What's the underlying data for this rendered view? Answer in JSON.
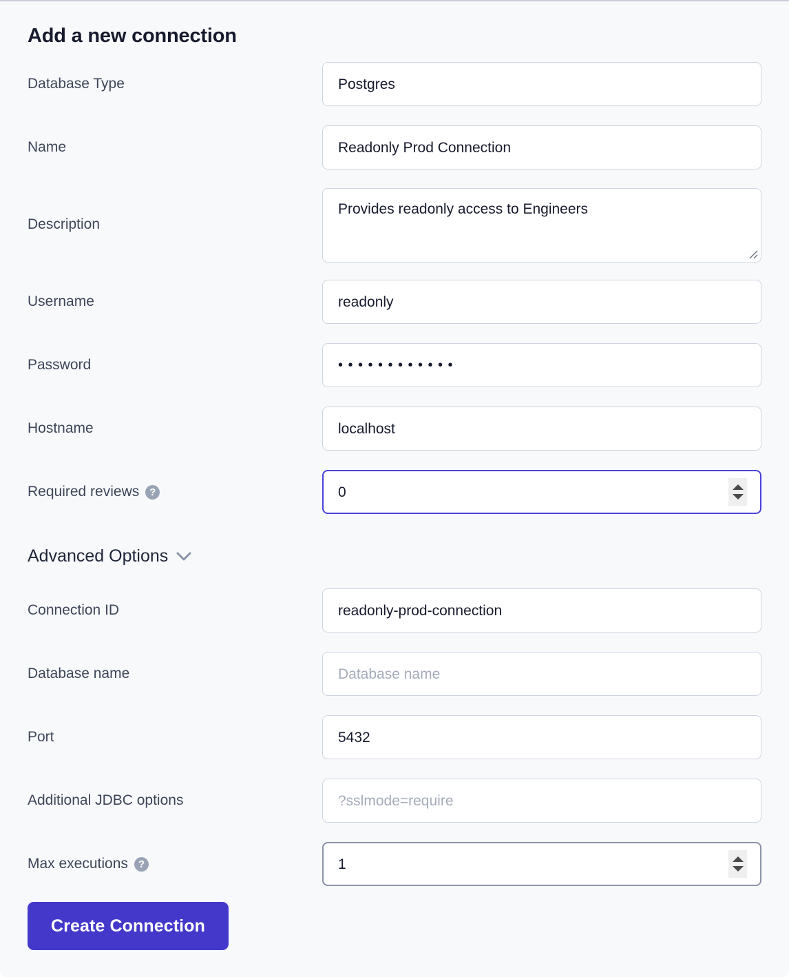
{
  "form": {
    "title": "Add a new connection",
    "submit_label": "Create Connection",
    "advanced": {
      "label": "Advanced Options",
      "chevron_icon": "chevron-down-icon",
      "expanded": true
    },
    "help_icon_glyph": "?",
    "accent_color": "#4338ca",
    "focus_border_color": "#4a43d6",
    "fields": [
      {
        "key": "database_type",
        "label": "Database Type",
        "value": "Postgres",
        "placeholder": "",
        "type": "select",
        "state": "default"
      },
      {
        "key": "name",
        "label": "Name",
        "value": "Readonly Prod Connection",
        "placeholder": "",
        "type": "text",
        "state": "default"
      },
      {
        "key": "description",
        "label": "Description",
        "value": "Provides readonly access to Engineers",
        "placeholder": "",
        "type": "textarea",
        "state": "default",
        "resizable": true
      },
      {
        "key": "username",
        "label": "Username",
        "value": "readonly",
        "placeholder": "",
        "type": "text",
        "state": "default"
      },
      {
        "key": "password",
        "label": "Password",
        "value": "••••••••••••",
        "placeholder": "",
        "type": "password",
        "state": "default"
      },
      {
        "key": "hostname",
        "label": "Hostname",
        "value": "localhost",
        "placeholder": "",
        "type": "text",
        "state": "default"
      },
      {
        "key": "required_reviews",
        "label": "Required reviews",
        "value": "0",
        "placeholder": "",
        "type": "number",
        "state": "focused",
        "has_help": true
      },
      {
        "key": "connection_id",
        "label": "Connection ID",
        "value": "readonly-prod-connection",
        "placeholder": "",
        "type": "text",
        "state": "default"
      },
      {
        "key": "database_name",
        "label": "Database name",
        "value": "",
        "placeholder": "Database name",
        "type": "text",
        "state": "default"
      },
      {
        "key": "port",
        "label": "Port",
        "value": "5432",
        "placeholder": "",
        "type": "text",
        "state": "default"
      },
      {
        "key": "additional_jdbc_options",
        "label": "Additional JDBC options",
        "value": "",
        "placeholder": "?sslmode=require",
        "type": "text",
        "state": "default"
      },
      {
        "key": "max_executions",
        "label": "Max executions",
        "value": "1",
        "placeholder": "",
        "type": "number",
        "state": "hover",
        "has_help": true
      }
    ]
  }
}
